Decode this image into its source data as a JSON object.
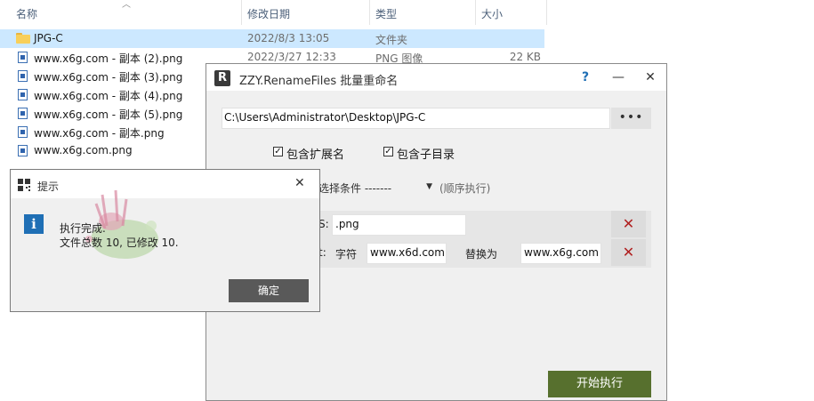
{
  "explorer": {
    "columns": [
      "名称",
      "修改日期",
      "类型",
      "大小"
    ],
    "rows": [
      {
        "name": "JPG-C",
        "date": "2022/8/3 13:05",
        "type": "文件夹",
        "size": "",
        "icon": "folder-icon",
        "selected": true
      },
      {
        "name": "www.x6g.com - 副本 (2).png",
        "date": "2022/3/27 12:33",
        "type": "PNG 图像",
        "size": "22 KB",
        "icon": "png-file-icon",
        "selected": false
      },
      {
        "name": "www.x6g.com - 副本 (3).png",
        "date": "",
        "type": "",
        "size": "",
        "icon": "png-file-icon",
        "selected": false
      },
      {
        "name": "www.x6g.com - 副本 (4).png",
        "date": "",
        "type": "",
        "size": "",
        "icon": "png-file-icon",
        "selected": false
      },
      {
        "name": "www.x6g.com - 副本 (5).png",
        "date": "",
        "type": "",
        "size": "",
        "icon": "png-file-icon",
        "selected": false
      },
      {
        "name": "www.x6g.com - 副本.png",
        "date": "",
        "type": "",
        "size": "",
        "icon": "png-file-icon",
        "selected": false
      },
      {
        "name": "www.x6g.com.png",
        "date": "",
        "type": "",
        "size": "",
        "icon": "png-file-icon",
        "selected": false
      }
    ]
  },
  "rename_window": {
    "logo": "R",
    "title": "ZZY.RenameFiles 批量重命名",
    "help": "?",
    "minimize": "—",
    "close": "✕",
    "path_value": "C:\\Users\\Administrator\\Desktop\\JPG-C",
    "browse_label": "•••",
    "include_ext_label": "包含扩展名",
    "include_subdir_label": "包含子目录",
    "checkmark": "✓",
    "condition_select": "选择条件 -------",
    "condition_hint": "(顺序执行)",
    "rule1": {
      "label": "S:",
      "value": ".png",
      "delete": "✕"
    },
    "rule2": {
      "label": "t:",
      "char_label": "字符",
      "find_value": "www.x6d.com",
      "replace_label": "替换为",
      "replace_value": "www.x6g.com",
      "delete": "✕"
    },
    "start_label": "开始执行"
  },
  "tips_dialog": {
    "title": "提示",
    "close": "✕",
    "info": "i",
    "line1": "执行完成.",
    "line2": "文件总数 10, 已修改 10.",
    "ok_label": "确定"
  }
}
